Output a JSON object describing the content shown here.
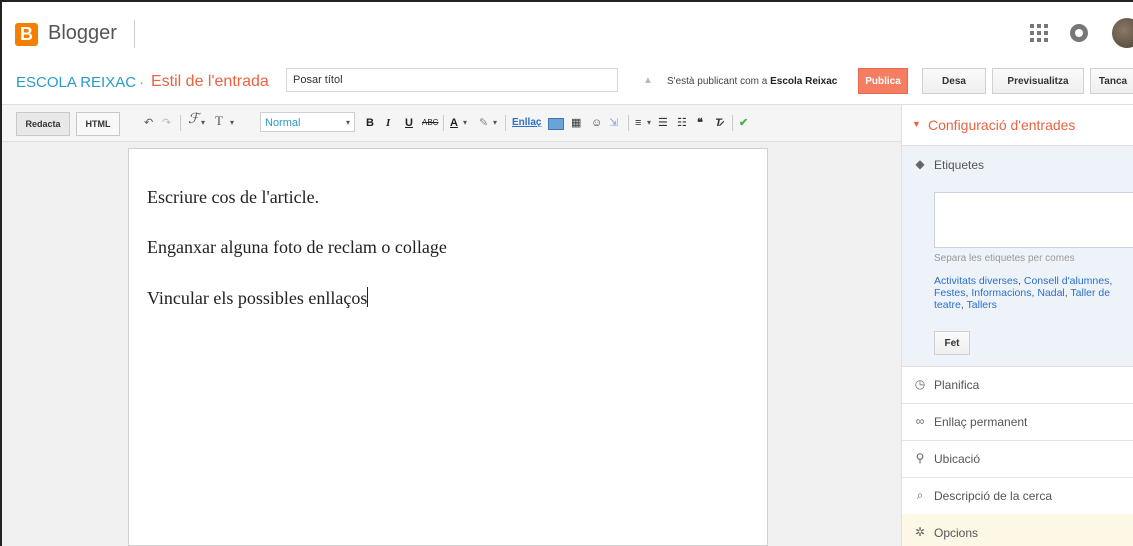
{
  "topbar": {
    "logo_letter": "B",
    "brand": "Blogger"
  },
  "titlebar": {
    "blog_name": "ESCOLA REIXAC",
    "separator": "·",
    "post_label": "Estil de l'entrada",
    "title_placeholder": "Posar títol",
    "warning_icon": "▲",
    "publishing_as_prefix": "S'està publicant com a",
    "publishing_as_name": "Escola Reixac",
    "publish": "Publica",
    "save": "Desa",
    "preview": "Previsualitza",
    "close": "Tanca"
  },
  "toolbar": {
    "compose": "Redacta",
    "html": "HTML",
    "format_value": "Normal",
    "link": "Enllaç"
  },
  "editor": {
    "paragraphs": [
      "Escriure cos de l'article.",
      "Enganxar alguna foto de reclam o collage",
      "Vincular els possibles enllaços"
    ]
  },
  "sidebar": {
    "header": "Configuració d'entrades",
    "labels": {
      "title": "Etiquetes",
      "hint": "Separa les etiquetes per comes",
      "items": [
        "Activitats diverses",
        "Consell d'alumnes",
        "Festes",
        "Informacions",
        "Nadal",
        "Taller de teatre",
        "Tallers"
      ],
      "done": "Fet"
    },
    "sections": [
      "Planifica",
      "Enllaç permanent",
      "Ubicació",
      "Descripció de la cerca",
      "Opcions"
    ]
  }
}
